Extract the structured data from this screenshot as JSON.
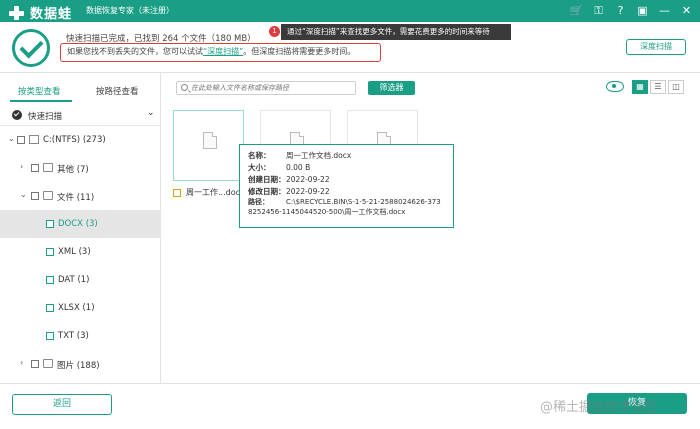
{
  "titlebar": {
    "app_name": "数据蛙",
    "subtitle": "数据恢复专家（未注册）",
    "controls": [
      "cart-icon",
      "key-icon",
      "help-icon",
      "save-icon",
      "minimize-icon",
      "close-icon"
    ]
  },
  "tooltip": {
    "badge": "1",
    "text": "通过“深度扫描”来查找更多文件，需要花费更多的时间来等待"
  },
  "status": {
    "scan_done": "快速扫描已完成，已找到  264  个文件（180 MB）",
    "hint_prefix": "如果您找不到丢失的文件，您可以试试",
    "hint_link": "“深度扫描”",
    "hint_suffix": "。但深度扫描将需要更多时间。",
    "deep_scan_button": "深度扫描"
  },
  "sidebar": {
    "tabs": [
      "按类型查看",
      "按路径查看"
    ],
    "quick_scan": "快速扫描",
    "tree": [
      {
        "label": "C:(NTFS) (273)"
      },
      {
        "label": "其他 (7)"
      },
      {
        "label": "文件 (11)"
      },
      {
        "label": "DOCX (3)"
      },
      {
        "label": "XML (3)"
      },
      {
        "label": "DAT (1)"
      },
      {
        "label": "XLSX (1)"
      },
      {
        "label": "TXT (3)"
      },
      {
        "label": "图片 (188)"
      }
    ]
  },
  "toolbar": {
    "search_placeholder": "在此处输入文件名称或保存路径",
    "filter_button": "筛选器"
  },
  "files": [
    {
      "name": "周一工作...docx"
    }
  ],
  "details": {
    "name_label": "名称：",
    "name": "周一工作文档.docx",
    "size_label": "大小：",
    "size": "0.00 B",
    "created_label": "创建日期：",
    "created": "2022-09-22",
    "modified_label": "修改日期：",
    "modified": "2022-09-22",
    "path_label": "路径：",
    "path": "C:\\$RECYCLE.BIN\\S-1-5-21-2588024626-3738252456-1145044520-500\\周一工作文档.docx"
  },
  "footer": {
    "back_button": "返回",
    "recover_button": "恢复"
  },
  "watermark": "@稀土掘金技术社区",
  "colors": {
    "accent": "#1a9e86",
    "alert": "#d64040"
  }
}
